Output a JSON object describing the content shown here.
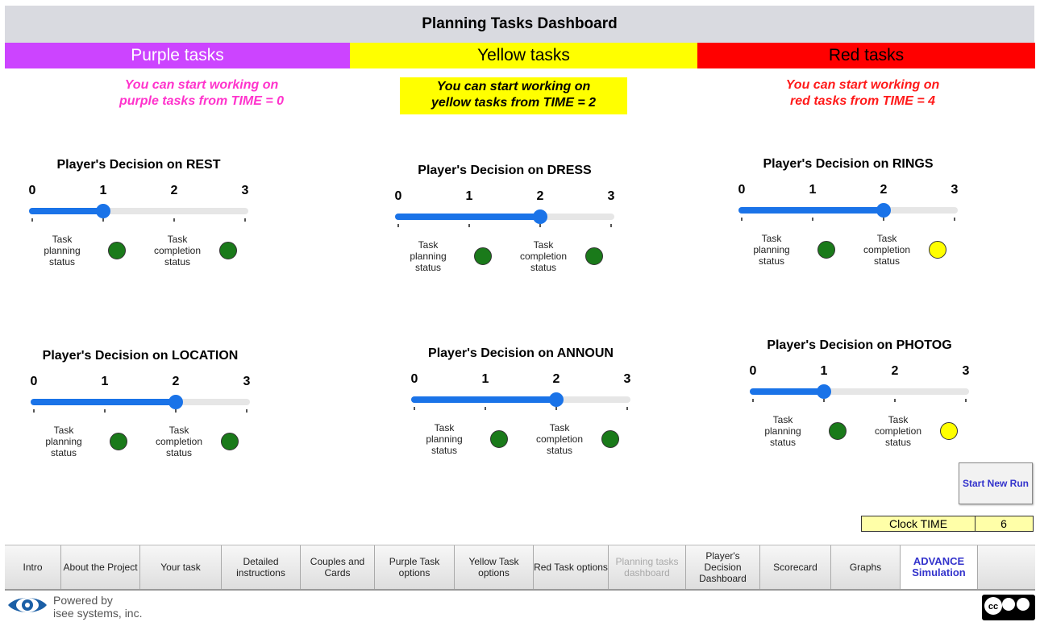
{
  "title": "Planning Tasks Dashboard",
  "columns": [
    {
      "header": "Purple tasks",
      "color": "#cc44ff",
      "note": "You can start working on\npurple tasks from TIME = 0",
      "note_color": "#ff33cc"
    },
    {
      "header": "Yellow tasks",
      "color": "#ffff00",
      "note": "You can start working on\nyellow tasks from TIME = 2",
      "note_color": "#000000"
    },
    {
      "header": "Red tasks",
      "color": "#ff0000",
      "note": "You can start working on\nred tasks from TIME = 4",
      "note_color": "#ff1a1a"
    }
  ],
  "decisions": [
    {
      "title": "Player's Decision on REST",
      "value": 1,
      "planning_label": "Task planning status",
      "completion_label": "Task completion status",
      "planning_status": "green",
      "completion_status": "green"
    },
    {
      "title": "Player's Decision on DRESS",
      "value": 2,
      "planning_label": "Task planning status",
      "completion_label": "Task completion status",
      "planning_status": "green",
      "completion_status": "green"
    },
    {
      "title": "Player's Decision on RINGS",
      "value": 2,
      "planning_label": "Task planning status",
      "completion_label": "Task completion status",
      "planning_status": "green",
      "completion_status": "yellow"
    },
    {
      "title": "Player's Decision on LOCATION",
      "value": 2,
      "planning_label": "Task planning status",
      "completion_label": "Task completion status",
      "planning_status": "green",
      "completion_status": "green"
    },
    {
      "title": "Player's Decision on ANNOUN",
      "value": 2,
      "planning_label": "Task planning status",
      "completion_label": "Task completion status",
      "planning_status": "green",
      "completion_status": "green"
    },
    {
      "title": "Player's Decision on PHOTOG",
      "value": 1,
      "planning_label": "Task planning status",
      "completion_label": "Task completion status",
      "planning_status": "green",
      "completion_status": "yellow"
    }
  ],
  "slider_ticks": [
    "0",
    "1",
    "2",
    "3"
  ],
  "status_colors": {
    "green": "#1a7a1a",
    "yellow": "#ffff00"
  },
  "start_button": "Start New Run",
  "clock": {
    "label": "Clock TIME",
    "value": "6"
  },
  "nav": [
    {
      "label": "Intro",
      "state": "normal"
    },
    {
      "label": "About the Project",
      "state": "normal"
    },
    {
      "label": "Your task",
      "state": "normal"
    },
    {
      "label": "Detailed instructions",
      "state": "normal"
    },
    {
      "label": "Couples and Cards",
      "state": "normal"
    },
    {
      "label": "Purple Task options",
      "state": "normal"
    },
    {
      "label": "Yellow Task options",
      "state": "normal"
    },
    {
      "label": "Red Task options",
      "state": "normal"
    },
    {
      "label": "Planning tasks dashboard",
      "state": "disabled"
    },
    {
      "label": "Player's Decision Dashboard",
      "state": "normal"
    },
    {
      "label": "Scorecard",
      "state": "normal"
    },
    {
      "label": "Graphs",
      "state": "normal"
    },
    {
      "label": "ADVANCE Simulation",
      "state": "advance"
    }
  ],
  "footer": {
    "powered_by": "Powered by\nisee systems, inc."
  },
  "icons": {
    "logo": "isee-eye-logo-icon",
    "license": "creative-commons-by-nc-nd-icon"
  }
}
